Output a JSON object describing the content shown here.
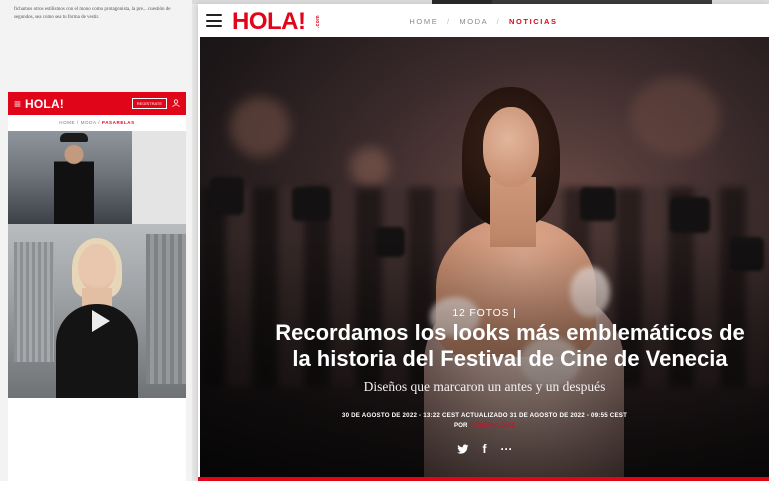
{
  "left_panel": {
    "intro_text": "fichamos otros estilismos con el mono como protagonista, la pre... cuestión de segundos, sea como sea tu forma de vestir.",
    "mini_header": {
      "menu_glyph": "≡",
      "logo": "HOLA!",
      "register_label": "REGÍSTRATE"
    },
    "mini_breadcrumb": {
      "home": "HOME",
      "section": "MODA",
      "current": "PASARELAS"
    }
  },
  "header": {
    "logo": "HOLA!",
    "logo_suffix": ".com",
    "breadcrumb": {
      "home": "HOME",
      "section": "MODA",
      "current": "NOTICIAS",
      "separator": "/"
    }
  },
  "article": {
    "kicker": "12 FOTOS |",
    "title_line1": "Recordamos los looks más emblemáticos de",
    "title_line2": "la historia del Festival de Cine de Venecia",
    "subtitle": "Diseños que marcaron un antes y un después",
    "dates": "30 DE AGOSTO DE 2022 - 13:22 CEST ACTUALIZADO 31 DE AGOSTO DE 2022 - 09:55 CEST",
    "author_prefix": "POR",
    "author_name": "ROSANA DÍAZ"
  },
  "share": {
    "facebook": "f",
    "more": "···"
  },
  "colors": {
    "brand_red": "#e1051a",
    "author_red": "#c0172a"
  },
  "icons": [
    "menu-icon",
    "user-icon",
    "play-icon",
    "twitter-icon",
    "facebook-icon",
    "more-icon"
  ]
}
